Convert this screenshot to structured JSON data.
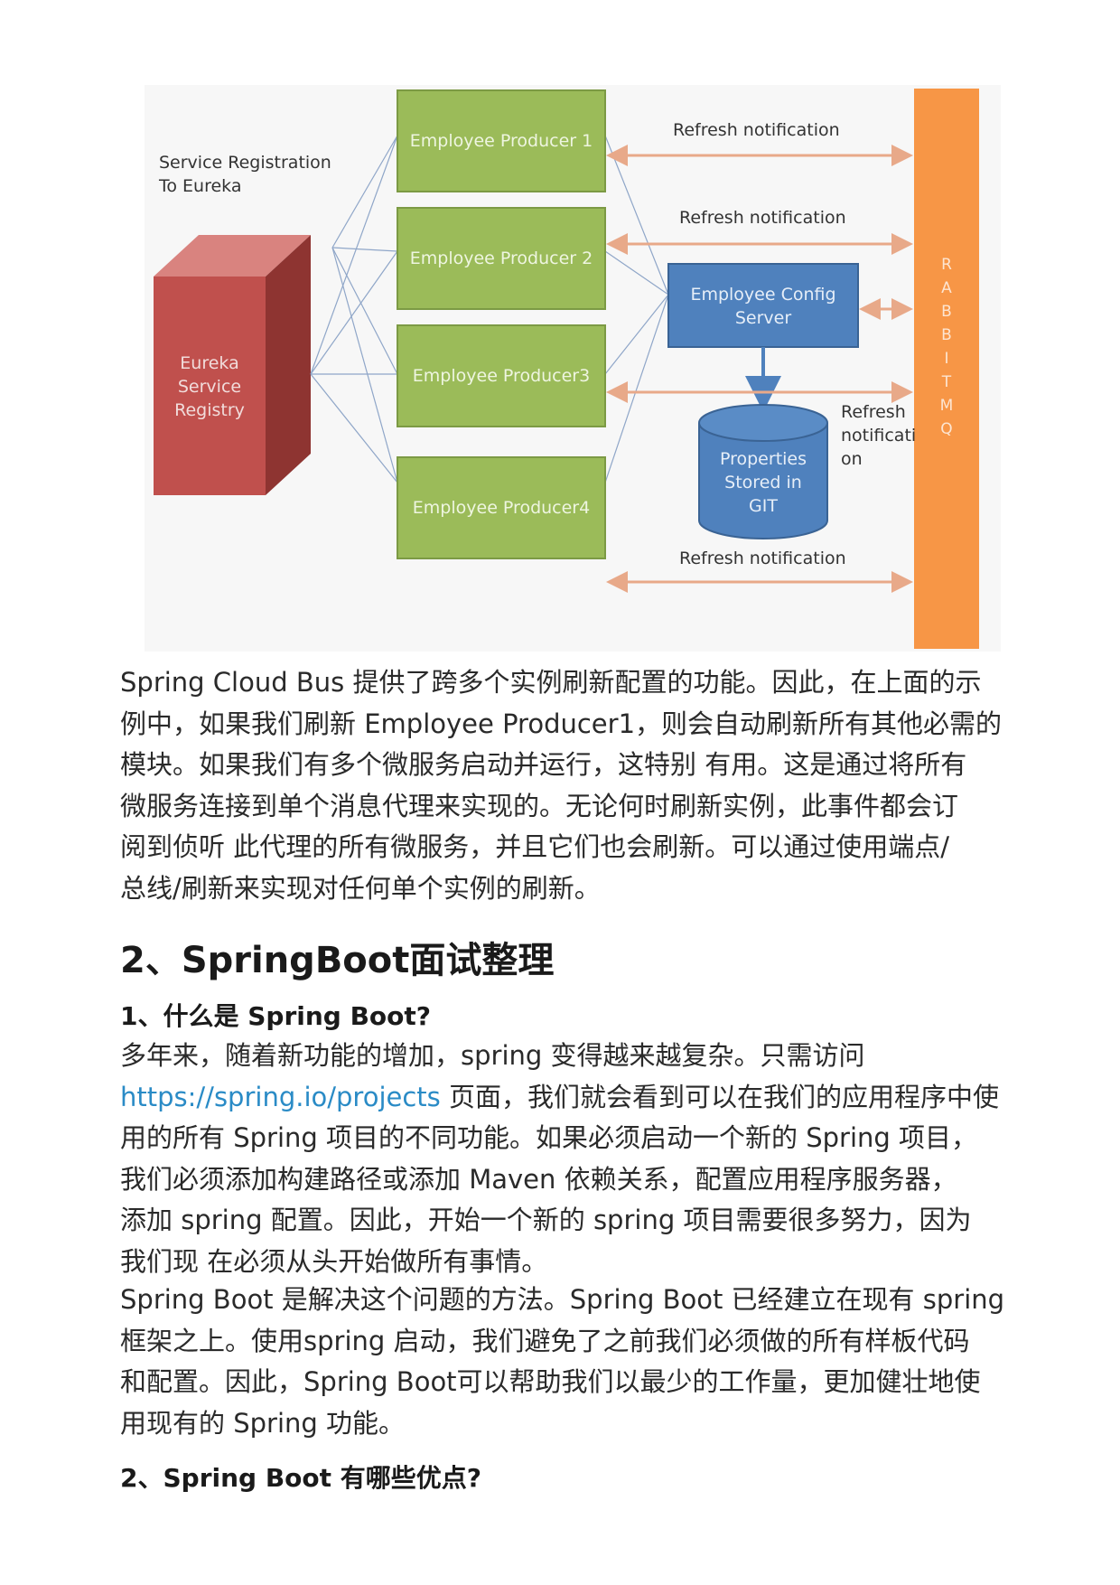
{
  "diagram": {
    "service_registration": [
      "Service Registration",
      "To Eureka"
    ],
    "eureka_registry": [
      "Eureka",
      "Service",
      "Registry"
    ],
    "producers": [
      "Employee Producer 1",
      "Employee Producer 2",
      "Employee Producer3",
      "Employee Producer4"
    ],
    "config_server": [
      "Employee Config",
      "Server"
    ],
    "git_store": [
      "Properties",
      "Stored in",
      "GIT"
    ],
    "refresh_labels": [
      "Refresh notification",
      "Refresh notification",
      "Refresh notification"
    ],
    "refresh_side": [
      "Refresh",
      "notificati",
      "on"
    ],
    "rabbitmq_letters": [
      "R",
      "A",
      "B",
      "B",
      "I",
      "T",
      "M",
      "Q"
    ],
    "colors": {
      "registry": "#c0504d",
      "producer": "#9bbb59",
      "config_server": "#4f81bd",
      "rabbitmq": "#f79646",
      "arrow": "#e8a989"
    }
  },
  "content": {
    "para1": "Spring Cloud Bus 提供了跨多个实例刷新配置的功能。因此，在上面的示\n例中，如果我们刷新 Employee Producer1，则会自动刷新所有其他必需的\n模块。如果我们有多个微服务启动并运行，这特别 有用。这是通过将所有\n微服务连接到单个消息代理来实现的。无论何时刷新实例，此事件都会订\n阅到侦听 此代理的所有微服务，并且它们也会刷新。可以通过使用端点/\n总线/刷新来实现对任何单个实例的刷新。",
    "heading2": "2、SpringBoot面试整理",
    "q1": "1、什么是 Spring Boot?",
    "para2_before": "多年来，随着新功能的增加，spring 变得越来越复杂。只需访问\n",
    "para2_link": "https://spring.io/projects",
    "para2_after": " 页面，我们就会看到可以在我们的应用程序中使\n用的所有 Spring 项目的不同功能。如果必须启动一个新的 Spring 项目，\n我们必须添加构建路径或添加 Maven 依赖关系，配置应用程序服务器，\n添加 spring 配置。因此，开始一个新的 spring 项目需要很多努力，因为\n我们现 在必须从头开始做所有事情。",
    "para3": "Spring Boot 是解决这个问题的方法。Spring Boot 已经建立在现有 spring\n框架之上。使用spring 启动，我们避免了之前我们必须做的所有样板代码\n和配置。因此，Spring Boot可以帮助我们以最少的工作量，更加健壮地使\n用现有的 Spring 功能。",
    "q2": "2、Spring Boot 有哪些优点?"
  }
}
